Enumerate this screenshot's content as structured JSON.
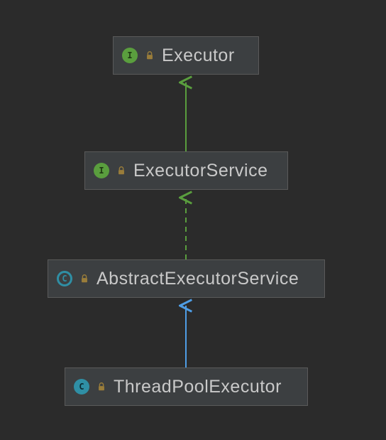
{
  "diagram": {
    "nodes": {
      "executor": {
        "label": "Executor",
        "kind": "interface",
        "badge_letter": "I"
      },
      "executor_service": {
        "label": "ExecutorService",
        "kind": "interface",
        "badge_letter": "I"
      },
      "abstract_executor_service": {
        "label": "AbstractExecutorService",
        "kind": "abstract-class",
        "badge_letter": "C"
      },
      "thread_pool_executor": {
        "label": "ThreadPoolExecutor",
        "kind": "class",
        "badge_letter": "C"
      }
    },
    "edges": [
      {
        "from": "executor_service",
        "to": "executor",
        "style": "solid",
        "color_role": "extends-interface"
      },
      {
        "from": "abstract_executor_service",
        "to": "executor_service",
        "style": "dashed",
        "color_role": "implements"
      },
      {
        "from": "thread_pool_executor",
        "to": "abstract_executor_service",
        "style": "solid",
        "color_role": "extends-class"
      }
    ],
    "colors": {
      "extends-interface": "#5a9e3e",
      "implements": "#5a9e3e",
      "extends-class": "#4f9ee6",
      "node_border": "#5a5a5a",
      "node_bg": "#3c3f41",
      "text": "#c9c9c9",
      "background": "#2b2b2b",
      "lock": "#9a7d3a"
    }
  }
}
